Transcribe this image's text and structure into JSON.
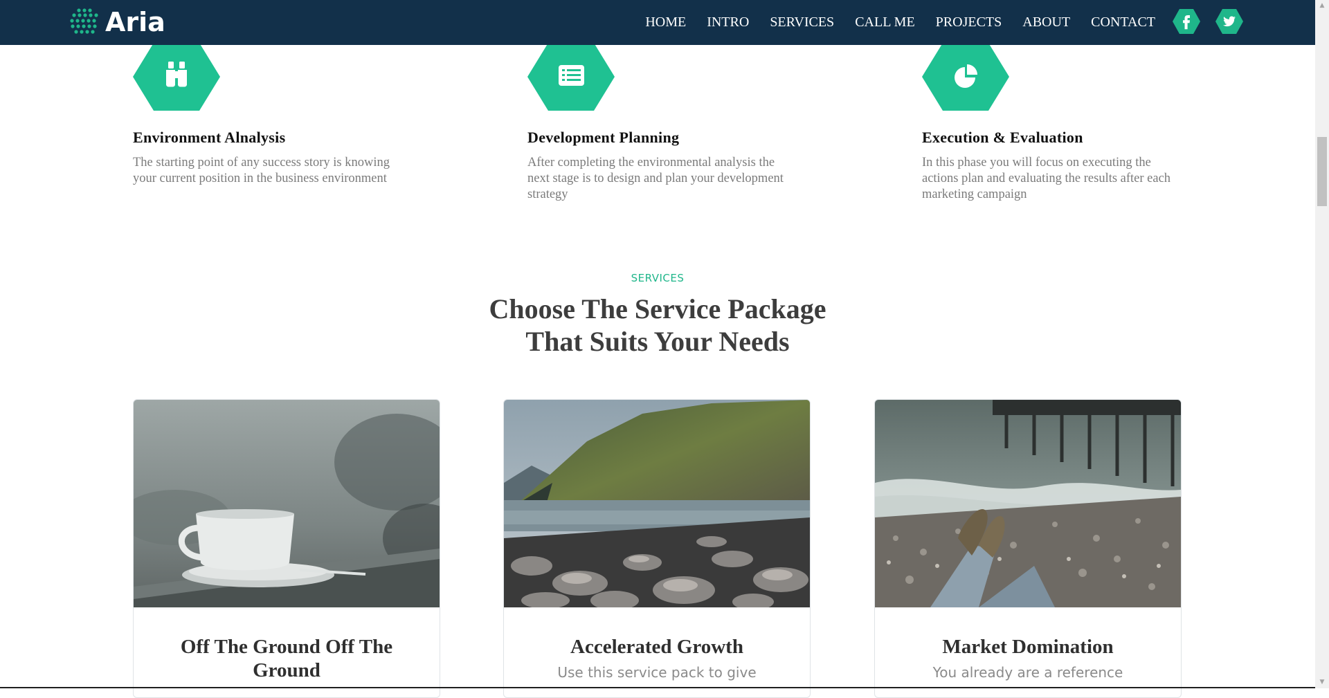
{
  "brand": {
    "name": "Aria",
    "accent": "#1fb68a",
    "nav_bg": "#12304a"
  },
  "nav": {
    "items": [
      {
        "label": "HOME"
      },
      {
        "label": "INTRO"
      },
      {
        "label": "SERVICES"
      },
      {
        "label": "CALL ME"
      },
      {
        "label": "PROJECTS"
      },
      {
        "label": "ABOUT"
      },
      {
        "label": "CONTACT"
      }
    ],
    "social": [
      {
        "icon": "facebook-icon"
      },
      {
        "icon": "twitter-icon"
      }
    ]
  },
  "steps": [
    {
      "icon": "binoculars-icon",
      "title": "Environment Alnalysis",
      "text": "The starting point of any success story is knowing your current position in the business environment"
    },
    {
      "icon": "list-icon",
      "title": "Development Planning",
      "text": "After completing the environmental analysis the next stage is to design and plan your development strategy"
    },
    {
      "icon": "pie-chart-icon",
      "title": "Execution & Evaluation",
      "text": "In this phase you will focus on executing the actions plan and evaluating the results after each marketing campaign"
    }
  ],
  "services": {
    "eyebrow": "SERVICES",
    "title_line1": "Choose The Service Package",
    "title_line2": "That Suits Your Needs",
    "cards": [
      {
        "image": "coffee-cup-photo",
        "title": "Off The Ground Off The Ground",
        "text": ""
      },
      {
        "image": "coastal-cliff-photo",
        "title": "Accelerated Growth",
        "text": "Use this service pack to give"
      },
      {
        "image": "pebble-beach-photo",
        "title": "Market Domination",
        "text": "You already are a reference"
      }
    ]
  }
}
